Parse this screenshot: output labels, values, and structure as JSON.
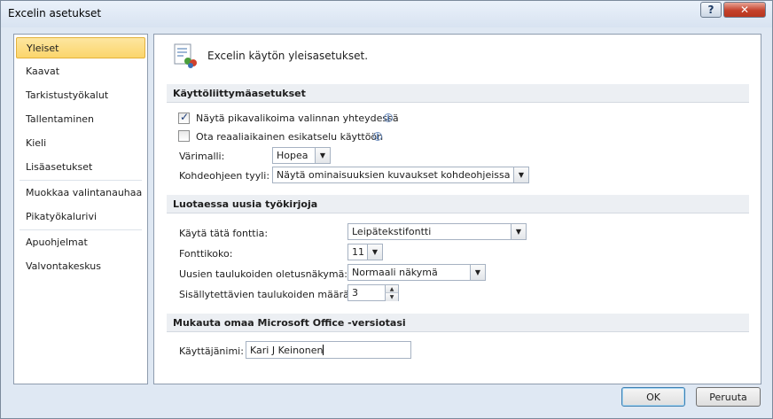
{
  "window": {
    "title": "Excelin asetukset"
  },
  "titlebar": {
    "help_glyph": "?",
    "close_glyph": "✕"
  },
  "nav": {
    "items": [
      {
        "label": "Yleiset",
        "selected": true
      },
      {
        "label": "Kaavat"
      },
      {
        "label": "Tarkistustyökalut"
      },
      {
        "label": "Tallentaminen"
      },
      {
        "label": "Kieli"
      },
      {
        "label": "Lisäasetukset"
      },
      {
        "label": "Muokkaa valintanauhaa"
      },
      {
        "label": "Pikatyökalurivi"
      },
      {
        "label": "Apuohjelmat"
      },
      {
        "label": "Valvontakeskus"
      }
    ]
  },
  "header": {
    "text": "Excelin käytön yleisasetukset.",
    "icon": "general-options-icon"
  },
  "ui_section": {
    "title": "Käyttöliittymäasetukset",
    "mini_toolbar": {
      "label": "Näytä pikavalikoima valinnan yhteydessä",
      "checked": true
    },
    "live_preview": {
      "label": "Ota reaaliaikainen esikatselu käyttöön",
      "checked": false
    },
    "color_scheme": {
      "label": "Värimalli:",
      "value": "Hopea"
    },
    "screentip": {
      "label": "Kohdeohjeen tyyli:",
      "value": "Näytä ominaisuuksien kuvaukset kohdeohjeissa"
    },
    "info_glyph": "i",
    "check_glyph": "✓"
  },
  "new_workbook_section": {
    "title": "Luotaessa uusia työkirjoja",
    "font": {
      "label": "Käytä tätä fonttia:",
      "value": "Leipätekstifontti"
    },
    "font_size": {
      "label": "Fonttikoko:",
      "value": "11"
    },
    "default_view": {
      "label": "Uusien taulukoiden oletusnäkymä:",
      "value": "Normaali näkymä"
    },
    "sheet_count": {
      "label": "Sisällytettävien taulukoiden määrä:",
      "value": "3"
    }
  },
  "personalize_section": {
    "title": "Mukauta omaa Microsoft Office -versiotasi",
    "username": {
      "label": "Käyttäjänimi:",
      "value": "Kari J Keinonen"
    }
  },
  "footer": {
    "ok_label": "OK",
    "cancel_label": "Peruuta"
  },
  "glyphs": {
    "dropdown": "▼",
    "spin_up": "▲",
    "spin_down": "▼"
  }
}
